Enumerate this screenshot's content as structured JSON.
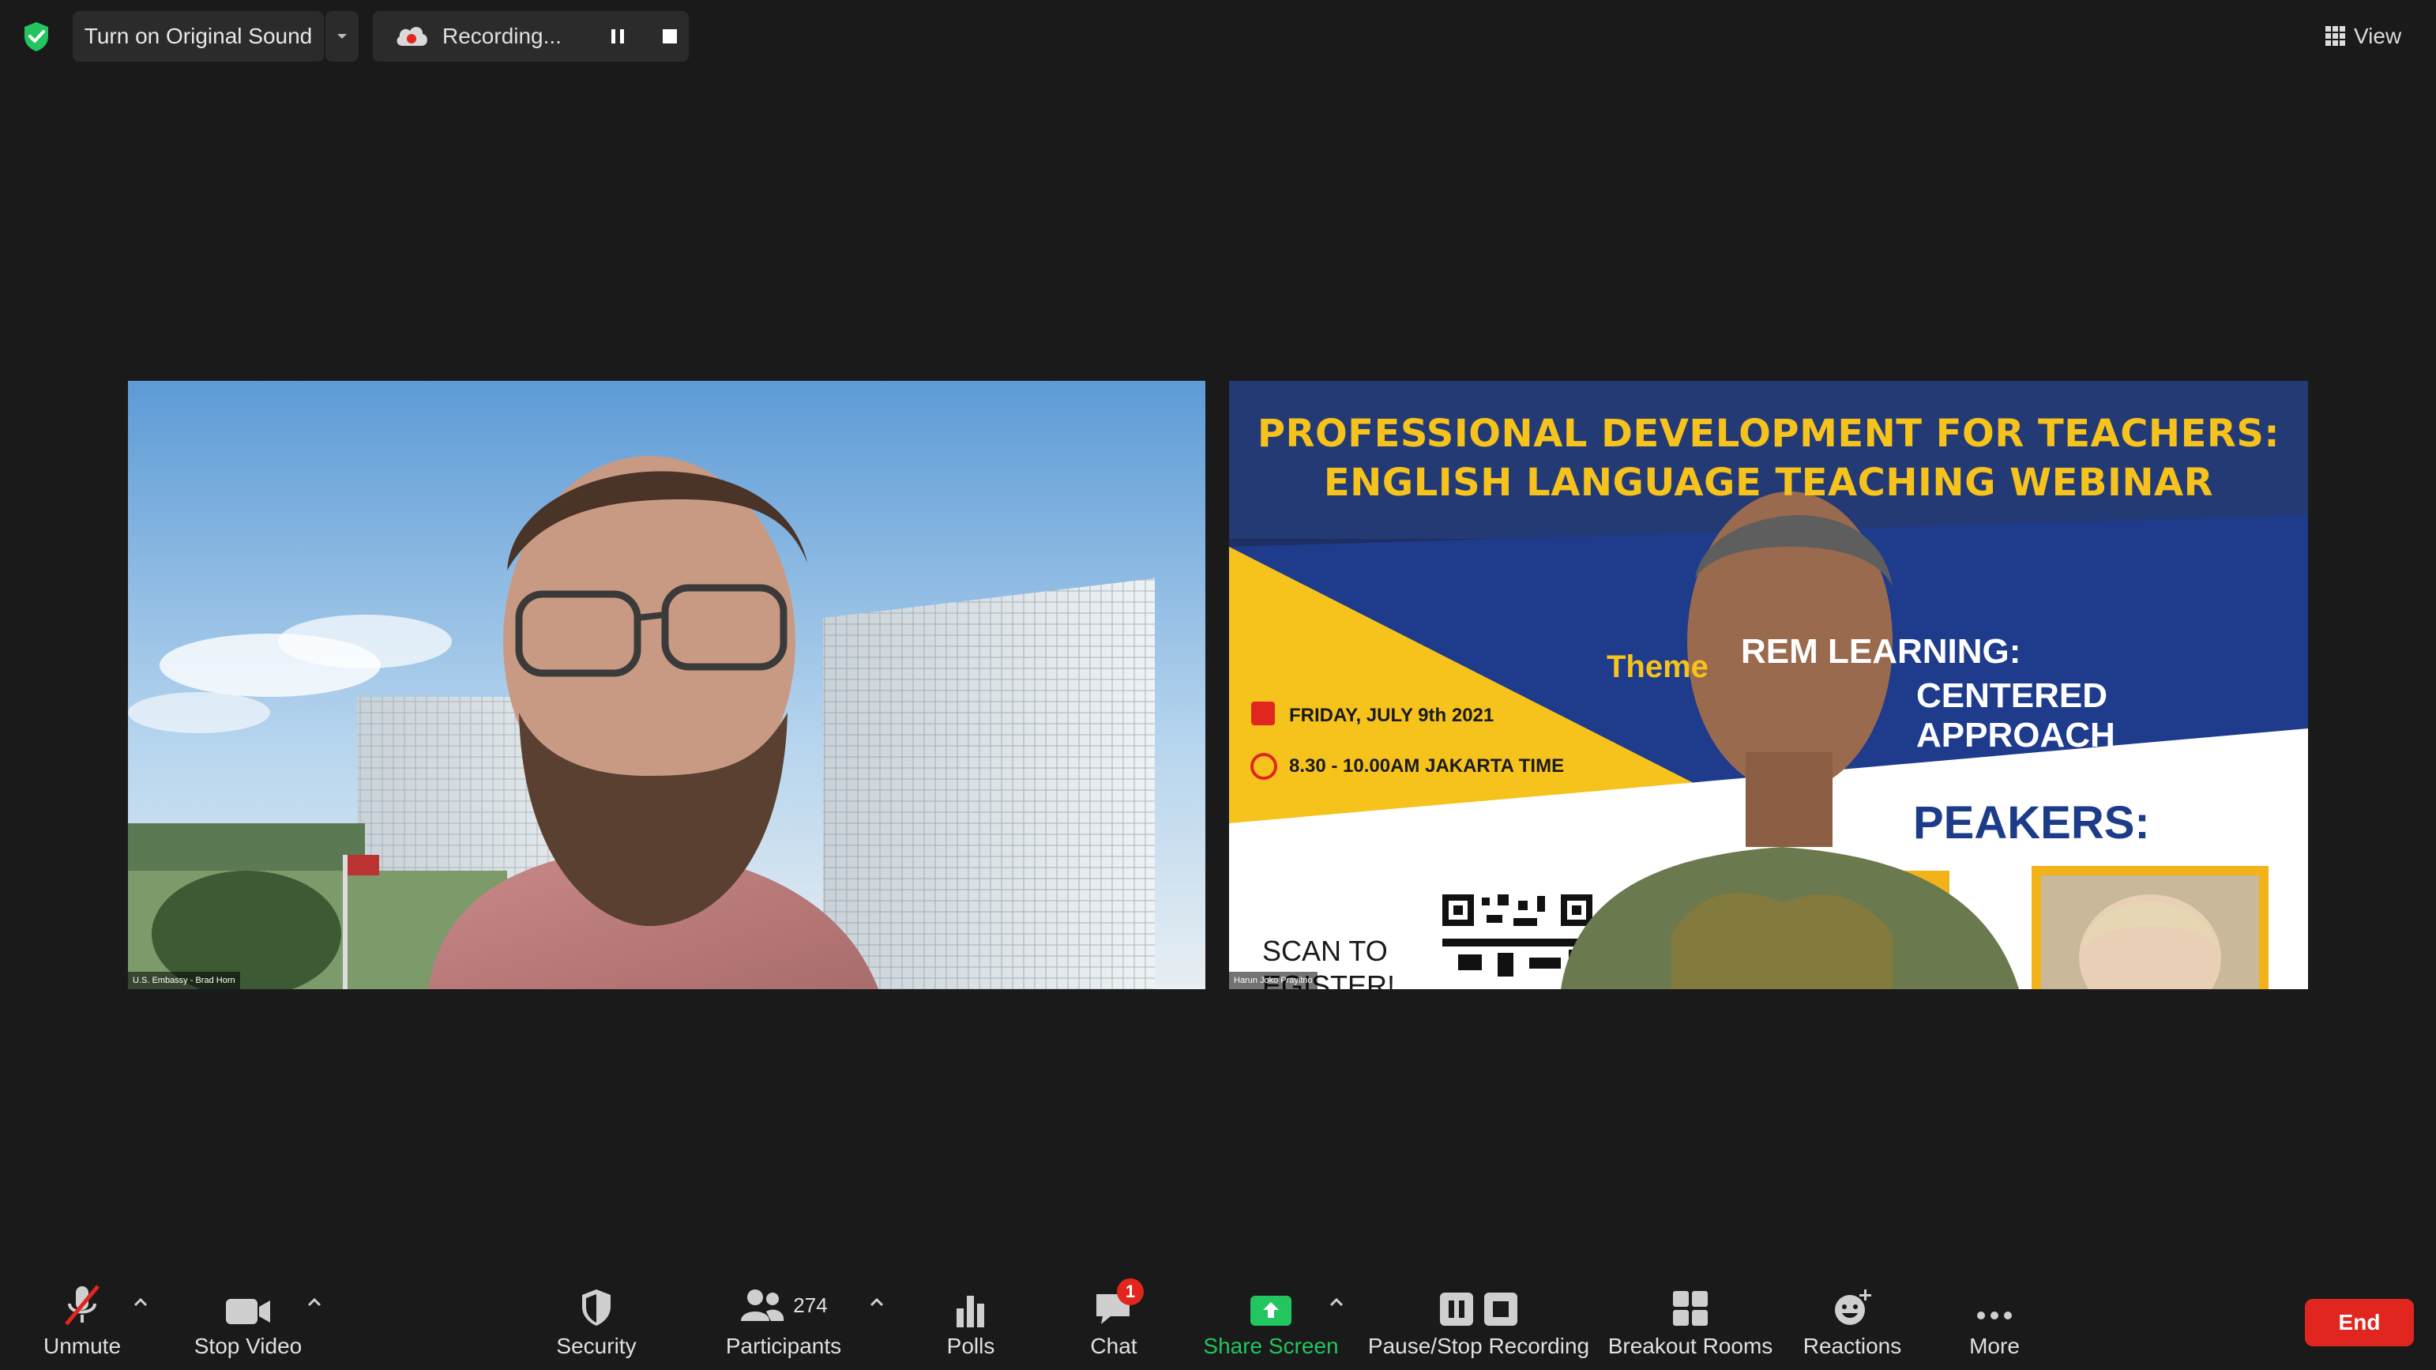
{
  "topbar": {
    "original_sound_label": "Turn on Original Sound",
    "recording_label": "Recording...",
    "view_label": "View"
  },
  "participants": {
    "left": {
      "name_tag": "U.S. Embassy - Brad Horn"
    },
    "right": {
      "name_tag": "Harun Joko Prayitno"
    }
  },
  "shared_poster": {
    "title_line1": "PROFESSIONAL DEVELOPMENT FOR TEACHERS:",
    "title_line2": "ENGLISH LANGUAGE TEACHING WEBINAR",
    "theme_label": "Theme",
    "theme_line1": "REM   LEARNING:",
    "theme_line2": "CENTERED APPROACH",
    "date": "FRIDAY, JULY 9th 2021",
    "time": "8.30 - 10.00AM JAKARTA TIME",
    "speakers_label": "PEAKERS:",
    "scan_text_1": "SCAN TO",
    "scan_text_2": "EGISTER!"
  },
  "toolbar": {
    "unmute": "Unmute",
    "stop_video": "Stop Video",
    "security": "Security",
    "participants_label": "Participants",
    "participants_count": "274",
    "polls": "Polls",
    "chat": "Chat",
    "chat_badge": "1",
    "share_screen": "Share Screen",
    "pause_stop_recording": "Pause/Stop Recording",
    "breakout_rooms": "Breakout Rooms",
    "reactions": "Reactions",
    "more": "More",
    "end": "End"
  },
  "colors": {
    "background": "#1a1a1a",
    "accent_green": "#22c55e",
    "end_red": "#e0261e",
    "poster_yellow": "#f6c21c",
    "poster_navy": "#1d2f63"
  },
  "icons": [
    "shield-check-icon",
    "caret-down-icon",
    "cloud-recording-icon",
    "pause-icon",
    "stop-icon",
    "grid-view-icon",
    "microphone-muted-icon",
    "video-camera-icon",
    "shield-icon",
    "participants-icon",
    "polls-icon",
    "chat-icon",
    "share-screen-icon",
    "breakout-rooms-icon",
    "reactions-icon",
    "more-icon"
  ]
}
